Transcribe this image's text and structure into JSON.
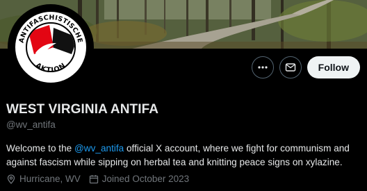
{
  "profile": {
    "display_name": "WEST VIRGINIA ANTIFA",
    "handle": "@wv_antifa",
    "bio": {
      "before": "Welcome to the ",
      "mention": "@wv_antifa",
      "after": " official X account, where we fight for communism and against fascism while sipping on herbal tea and knitting peace signs on xylazine."
    },
    "location": "Hurricane, WV",
    "joined": "Joined October 2023"
  },
  "avatar": {
    "logo_text_top": "ANTIFASCHISTISCHE",
    "logo_text_bottom": "AKTION"
  },
  "actions": {
    "more_icon": "more-horizontal-icon",
    "message_icon": "envelope-icon",
    "follow_label": "Follow"
  },
  "colors": {
    "background": "#000000",
    "text_primary": "#e7e9ea",
    "text_secondary": "#71767b",
    "link": "#1d9bf0",
    "follow_bg": "#eff3f4",
    "logo_red": "#e30613"
  }
}
